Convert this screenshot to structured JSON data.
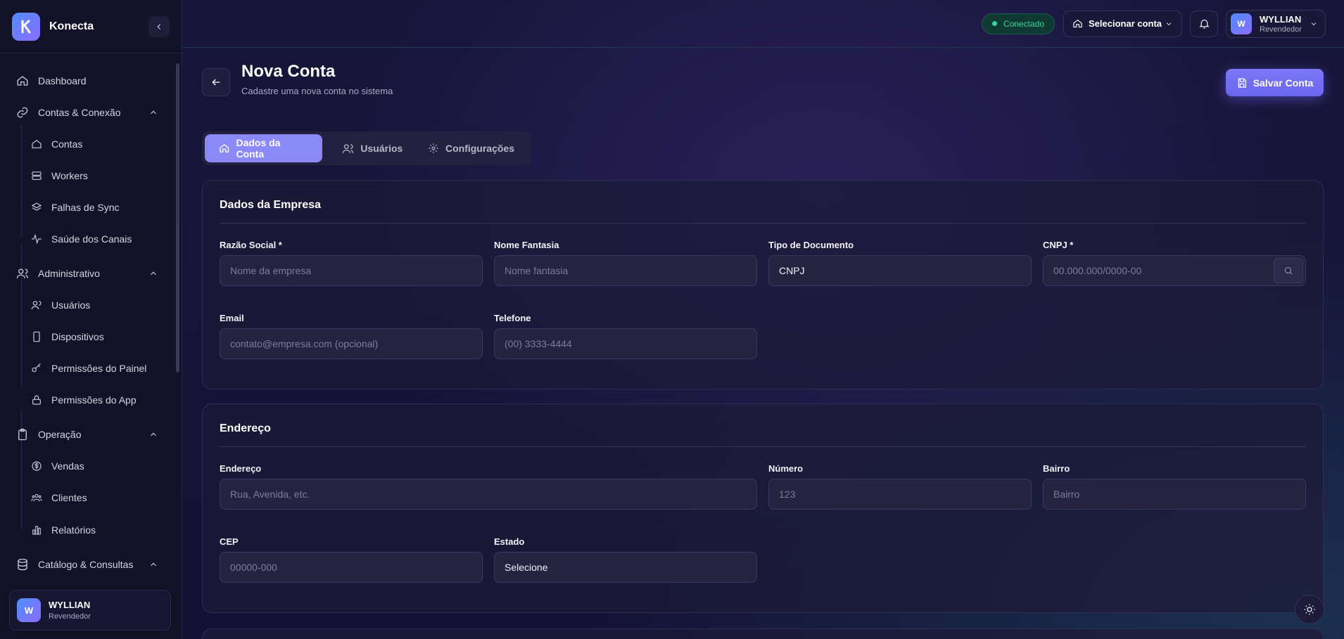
{
  "app": {
    "name": "Konecta"
  },
  "sidebar": {
    "items": [
      {
        "label": "Dashboard",
        "icon": "home-icon"
      },
      {
        "label": "Contas & Conexão",
        "icon": "link-icon",
        "expanded": true
      },
      {
        "label": "Contas",
        "icon": "building-icon"
      },
      {
        "label": "Workers",
        "icon": "server-icon"
      },
      {
        "label": "Falhas de Sync",
        "icon": "layers-icon"
      },
      {
        "label": "Saúde dos Canais",
        "icon": "activity-icon"
      },
      {
        "label": "Administrativo",
        "icon": "users-icon",
        "expanded": true
      },
      {
        "label": "Usuários",
        "icon": "users-icon"
      },
      {
        "label": "Dispositivos",
        "icon": "phone-icon"
      },
      {
        "label": "Permissões do Painel",
        "icon": "key-icon"
      },
      {
        "label": "Permissões do App",
        "icon": "lock-icon"
      },
      {
        "label": "Operação",
        "icon": "clipboard-icon",
        "expanded": true
      },
      {
        "label": "Vendas",
        "icon": "dollar-icon"
      },
      {
        "label": "Clientes",
        "icon": "group-icon"
      },
      {
        "label": "Relatórios",
        "icon": "bar-chart-icon"
      },
      {
        "label": "Catálogo & Consultas",
        "icon": "database-icon",
        "expanded": true
      }
    ],
    "user": {
      "initial": "W",
      "name": "WYLLIAN",
      "role": "Revendedor"
    }
  },
  "topbar": {
    "status": "Conectado",
    "account_selector": "Selecionar conta",
    "user": {
      "initial": "W",
      "name": "WYLLIAN",
      "role": "Revendedor"
    }
  },
  "page": {
    "title": "Nova Conta",
    "subtitle": "Cadastre uma nova conta no sistema",
    "save_label": "Salvar Conta"
  },
  "tabs": [
    {
      "label": "Dados da Conta",
      "active": true
    },
    {
      "label": "Usuários",
      "active": false
    },
    {
      "label": "Configurações",
      "active": false
    }
  ],
  "company": {
    "title": "Dados da Empresa",
    "razao": {
      "label": "Razão Social *",
      "placeholder": "Nome da empresa"
    },
    "fantasia": {
      "label": "Nome Fantasia",
      "placeholder": "Nome fantasia"
    },
    "tipo_doc": {
      "label": "Tipo de Documento",
      "value": "CNPJ"
    },
    "cnpj": {
      "label": "CNPJ *",
      "placeholder": "00.000.000/0000-00"
    },
    "email": {
      "label": "Email",
      "placeholder": "contato@empresa.com (opcional)"
    },
    "telefone": {
      "label": "Telefone",
      "placeholder": "(00) 3333-4444"
    }
  },
  "address": {
    "title": "Endereço",
    "endereco": {
      "label": "Endereço",
      "placeholder": "Rua, Avenida, etc."
    },
    "numero": {
      "label": "Número",
      "placeholder": "123"
    },
    "bairro": {
      "label": "Bairro",
      "placeholder": "Bairro"
    },
    "cep": {
      "label": "CEP",
      "placeholder": "00000-000"
    },
    "estado": {
      "label": "Estado",
      "value": "Selecione"
    }
  },
  "colors": {
    "accent": "#8b88f8",
    "success": "#34d399",
    "background": "#141234"
  }
}
